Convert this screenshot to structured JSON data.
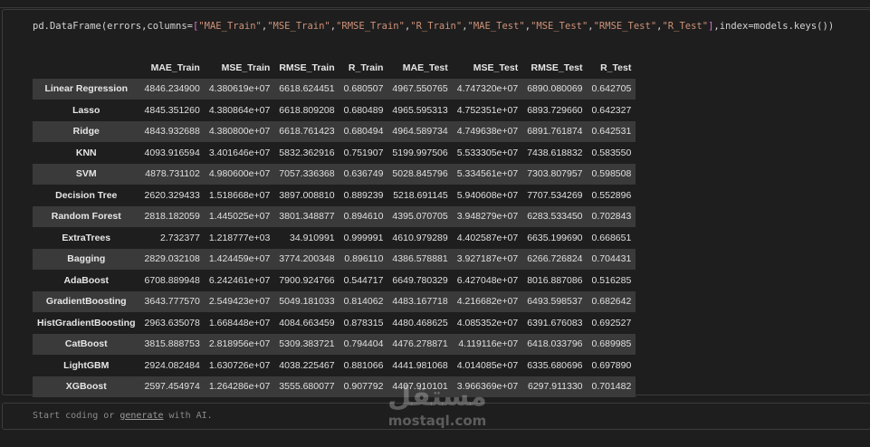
{
  "code": {
    "prefix": "pd.DataFrame(errors,columns=",
    "cols": [
      "\"MAE_Train\"",
      "\"MSE_Train\"",
      "\"RMSE_Train\"",
      "\"R_Train\"",
      "\"MAE_Test\"",
      "\"MSE_Test\"",
      "\"RMSE_Test\"",
      "\"R_Test\""
    ],
    "suffix": ",index=models.keys())"
  },
  "table": {
    "columns": [
      "MAE_Train",
      "MSE_Train",
      "RMSE_Train",
      "R_Train",
      "MAE_Test",
      "MSE_Test",
      "RMSE_Test",
      "R_Test"
    ],
    "rows": [
      {
        "model": "Linear Regression",
        "values": [
          "4846.234900",
          "4.380619e+07",
          "6618.624451",
          "0.680507",
          "4967.550765",
          "4.747320e+07",
          "6890.080069",
          "0.642705"
        ]
      },
      {
        "model": "Lasso",
        "values": [
          "4845.351260",
          "4.380864e+07",
          "6618.809208",
          "0.680489",
          "4965.595313",
          "4.752351e+07",
          "6893.729660",
          "0.642327"
        ]
      },
      {
        "model": "Ridge",
        "values": [
          "4843.932688",
          "4.380800e+07",
          "6618.761423",
          "0.680494",
          "4964.589734",
          "4.749638e+07",
          "6891.761874",
          "0.642531"
        ]
      },
      {
        "model": "KNN",
        "values": [
          "4093.916594",
          "3.401646e+07",
          "5832.362916",
          "0.751907",
          "5199.997506",
          "5.533305e+07",
          "7438.618832",
          "0.583550"
        ]
      },
      {
        "model": "SVM",
        "values": [
          "4878.731102",
          "4.980600e+07",
          "7057.336368",
          "0.636749",
          "5028.845796",
          "5.334561e+07",
          "7303.807957",
          "0.598508"
        ]
      },
      {
        "model": "Decision Tree",
        "values": [
          "2620.329433",
          "1.518668e+07",
          "3897.008810",
          "0.889239",
          "5218.691145",
          "5.940608e+07",
          "7707.534269",
          "0.552896"
        ]
      },
      {
        "model": "Random Forest",
        "values": [
          "2818.182059",
          "1.445025e+07",
          "3801.348877",
          "0.894610",
          "4395.070705",
          "3.948279e+07",
          "6283.533450",
          "0.702843"
        ]
      },
      {
        "model": "ExtraTrees",
        "values": [
          "2.732377",
          "1.218777e+03",
          "34.910991",
          "0.999991",
          "4610.979289",
          "4.402587e+07",
          "6635.199690",
          "0.668651"
        ]
      },
      {
        "model": "Bagging",
        "values": [
          "2829.032108",
          "1.424459e+07",
          "3774.200348",
          "0.896110",
          "4386.578881",
          "3.927187e+07",
          "6266.726824",
          "0.704431"
        ]
      },
      {
        "model": "AdaBoost",
        "values": [
          "6708.889948",
          "6.242461e+07",
          "7900.924766",
          "0.544717",
          "6649.780329",
          "6.427048e+07",
          "8016.887086",
          "0.516285"
        ]
      },
      {
        "model": "GradientBoosting",
        "values": [
          "3643.777570",
          "2.549423e+07",
          "5049.181033",
          "0.814062",
          "4483.167718",
          "4.216682e+07",
          "6493.598537",
          "0.682642"
        ]
      },
      {
        "model": "HistGradientBoosting",
        "values": [
          "2963.635078",
          "1.668448e+07",
          "4084.663459",
          "0.878315",
          "4480.468625",
          "4.085352e+07",
          "6391.676083",
          "0.692527"
        ]
      },
      {
        "model": "CatBoost",
        "values": [
          "3815.888753",
          "2.818956e+07",
          "5309.383721",
          "0.794404",
          "4476.278871",
          "4.119116e+07",
          "6418.033796",
          "0.689985"
        ]
      },
      {
        "model": "LightGBM",
        "values": [
          "2924.082484",
          "1.630726e+07",
          "4038.225467",
          "0.881066",
          "4441.981068",
          "4.014085e+07",
          "6335.680696",
          "0.697890"
        ]
      },
      {
        "model": "XGBoost",
        "values": [
          "2597.454974",
          "1.264286e+07",
          "3555.680077",
          "0.907792",
          "4407.910101",
          "3.966369e+07",
          "6297.911330",
          "0.701482"
        ]
      }
    ]
  },
  "new_cell": {
    "before": "Start coding or ",
    "link": "generate",
    "after": " with AI."
  },
  "watermark": {
    "arabic": "مستقل",
    "latin": "mostaql.com"
  }
}
